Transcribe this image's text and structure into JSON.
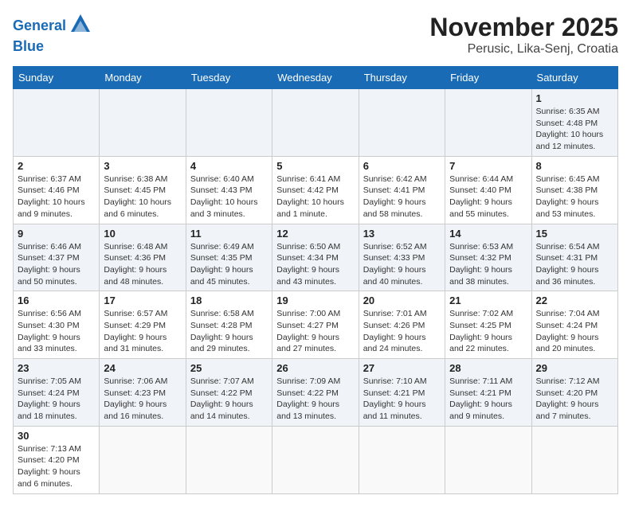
{
  "logo": {
    "line1": "General",
    "line2": "Blue"
  },
  "title": "November 2025",
  "subtitle": "Perusic, Lika-Senj, Croatia",
  "weekdays": [
    "Sunday",
    "Monday",
    "Tuesday",
    "Wednesday",
    "Thursday",
    "Friday",
    "Saturday"
  ],
  "weeks": [
    [
      {
        "day": "",
        "info": ""
      },
      {
        "day": "",
        "info": ""
      },
      {
        "day": "",
        "info": ""
      },
      {
        "day": "",
        "info": ""
      },
      {
        "day": "",
        "info": ""
      },
      {
        "day": "",
        "info": ""
      },
      {
        "day": "1",
        "info": "Sunrise: 6:35 AM\nSunset: 4:48 PM\nDaylight: 10 hours and 12 minutes."
      }
    ],
    [
      {
        "day": "2",
        "info": "Sunrise: 6:37 AM\nSunset: 4:46 PM\nDaylight: 10 hours and 9 minutes."
      },
      {
        "day": "3",
        "info": "Sunrise: 6:38 AM\nSunset: 4:45 PM\nDaylight: 10 hours and 6 minutes."
      },
      {
        "day": "4",
        "info": "Sunrise: 6:40 AM\nSunset: 4:43 PM\nDaylight: 10 hours and 3 minutes."
      },
      {
        "day": "5",
        "info": "Sunrise: 6:41 AM\nSunset: 4:42 PM\nDaylight: 10 hours and 1 minute."
      },
      {
        "day": "6",
        "info": "Sunrise: 6:42 AM\nSunset: 4:41 PM\nDaylight: 9 hours and 58 minutes."
      },
      {
        "day": "7",
        "info": "Sunrise: 6:44 AM\nSunset: 4:40 PM\nDaylight: 9 hours and 55 minutes."
      },
      {
        "day": "8",
        "info": "Sunrise: 6:45 AM\nSunset: 4:38 PM\nDaylight: 9 hours and 53 minutes."
      }
    ],
    [
      {
        "day": "9",
        "info": "Sunrise: 6:46 AM\nSunset: 4:37 PM\nDaylight: 9 hours and 50 minutes."
      },
      {
        "day": "10",
        "info": "Sunrise: 6:48 AM\nSunset: 4:36 PM\nDaylight: 9 hours and 48 minutes."
      },
      {
        "day": "11",
        "info": "Sunrise: 6:49 AM\nSunset: 4:35 PM\nDaylight: 9 hours and 45 minutes."
      },
      {
        "day": "12",
        "info": "Sunrise: 6:50 AM\nSunset: 4:34 PM\nDaylight: 9 hours and 43 minutes."
      },
      {
        "day": "13",
        "info": "Sunrise: 6:52 AM\nSunset: 4:33 PM\nDaylight: 9 hours and 40 minutes."
      },
      {
        "day": "14",
        "info": "Sunrise: 6:53 AM\nSunset: 4:32 PM\nDaylight: 9 hours and 38 minutes."
      },
      {
        "day": "15",
        "info": "Sunrise: 6:54 AM\nSunset: 4:31 PM\nDaylight: 9 hours and 36 minutes."
      }
    ],
    [
      {
        "day": "16",
        "info": "Sunrise: 6:56 AM\nSunset: 4:30 PM\nDaylight: 9 hours and 33 minutes."
      },
      {
        "day": "17",
        "info": "Sunrise: 6:57 AM\nSunset: 4:29 PM\nDaylight: 9 hours and 31 minutes."
      },
      {
        "day": "18",
        "info": "Sunrise: 6:58 AM\nSunset: 4:28 PM\nDaylight: 9 hours and 29 minutes."
      },
      {
        "day": "19",
        "info": "Sunrise: 7:00 AM\nSunset: 4:27 PM\nDaylight: 9 hours and 27 minutes."
      },
      {
        "day": "20",
        "info": "Sunrise: 7:01 AM\nSunset: 4:26 PM\nDaylight: 9 hours and 24 minutes."
      },
      {
        "day": "21",
        "info": "Sunrise: 7:02 AM\nSunset: 4:25 PM\nDaylight: 9 hours and 22 minutes."
      },
      {
        "day": "22",
        "info": "Sunrise: 7:04 AM\nSunset: 4:24 PM\nDaylight: 9 hours and 20 minutes."
      }
    ],
    [
      {
        "day": "23",
        "info": "Sunrise: 7:05 AM\nSunset: 4:24 PM\nDaylight: 9 hours and 18 minutes."
      },
      {
        "day": "24",
        "info": "Sunrise: 7:06 AM\nSunset: 4:23 PM\nDaylight: 9 hours and 16 minutes."
      },
      {
        "day": "25",
        "info": "Sunrise: 7:07 AM\nSunset: 4:22 PM\nDaylight: 9 hours and 14 minutes."
      },
      {
        "day": "26",
        "info": "Sunrise: 7:09 AM\nSunset: 4:22 PM\nDaylight: 9 hours and 13 minutes."
      },
      {
        "day": "27",
        "info": "Sunrise: 7:10 AM\nSunset: 4:21 PM\nDaylight: 9 hours and 11 minutes."
      },
      {
        "day": "28",
        "info": "Sunrise: 7:11 AM\nSunset: 4:21 PM\nDaylight: 9 hours and 9 minutes."
      },
      {
        "day": "29",
        "info": "Sunrise: 7:12 AM\nSunset: 4:20 PM\nDaylight: 9 hours and 7 minutes."
      }
    ],
    [
      {
        "day": "30",
        "info": "Sunrise: 7:13 AM\nSunset: 4:20 PM\nDaylight: 9 hours and 6 minutes."
      },
      {
        "day": "",
        "info": ""
      },
      {
        "day": "",
        "info": ""
      },
      {
        "day": "",
        "info": ""
      },
      {
        "day": "",
        "info": ""
      },
      {
        "day": "",
        "info": ""
      },
      {
        "day": "",
        "info": ""
      }
    ]
  ]
}
